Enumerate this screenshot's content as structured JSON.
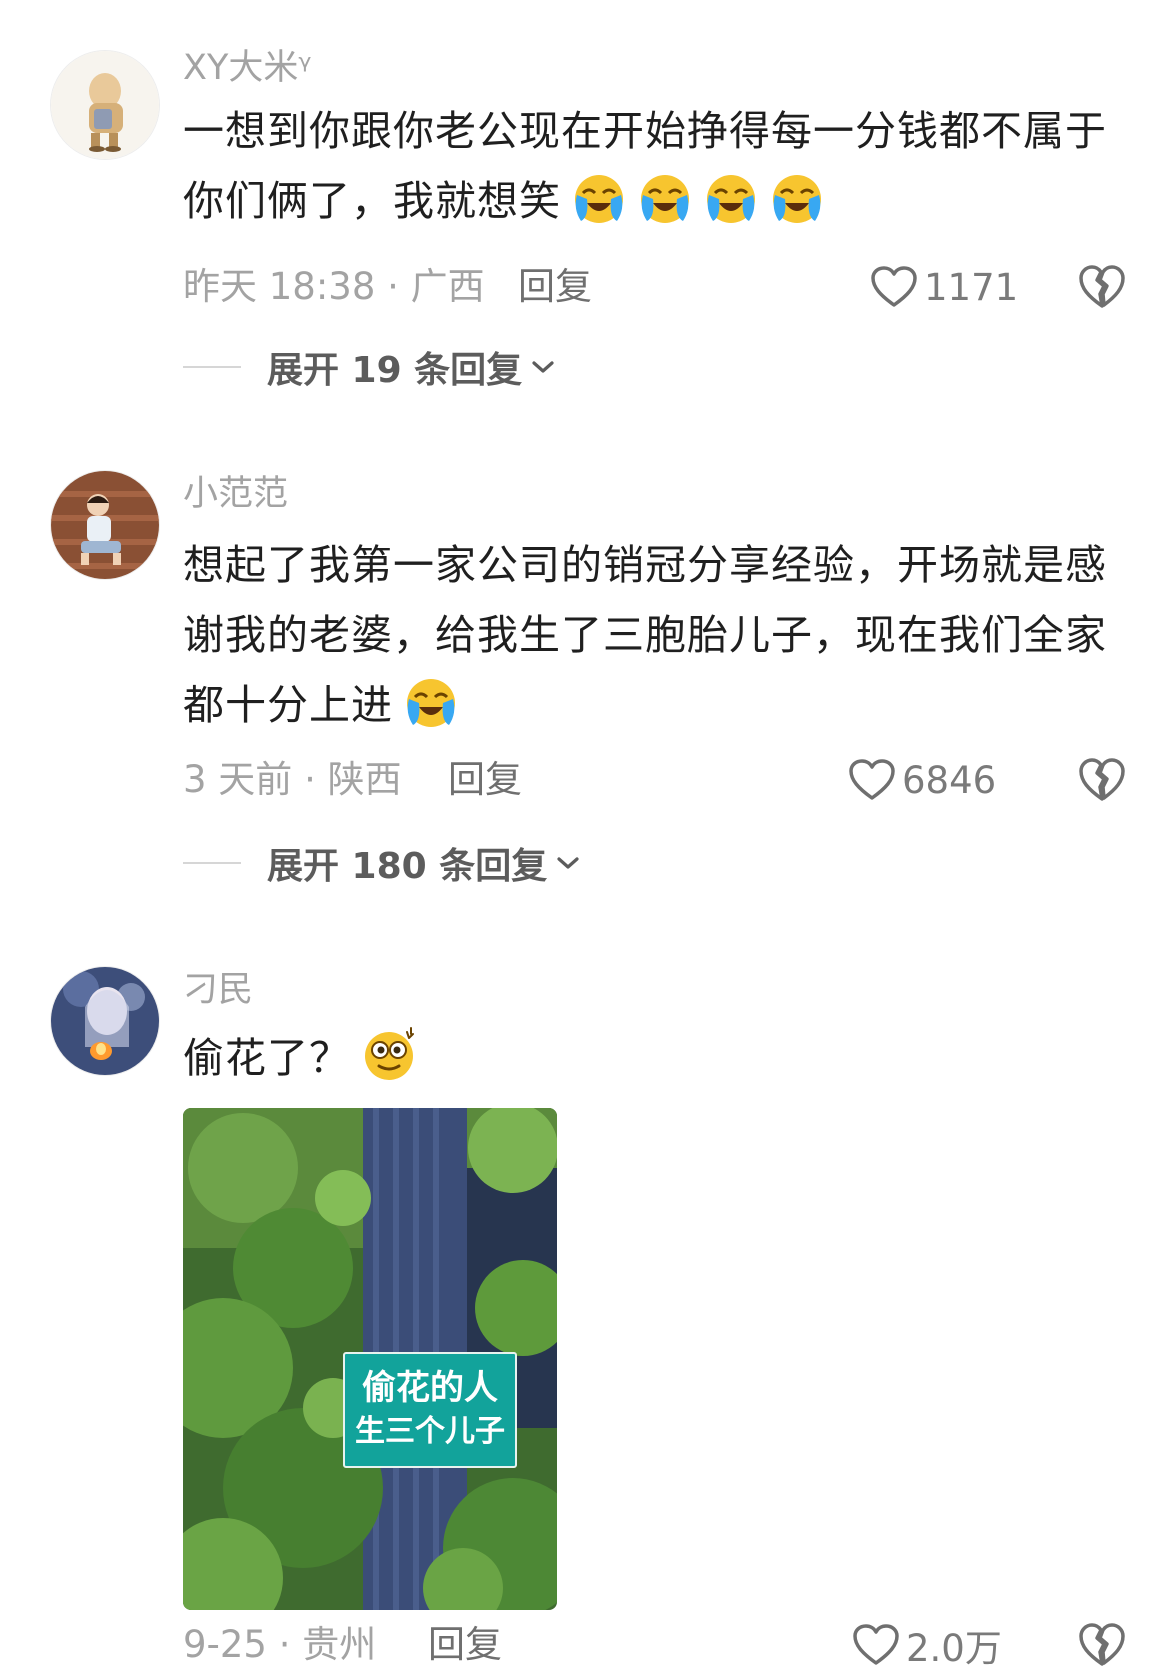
{
  "comments": [
    {
      "username": "XY大米ᵞ",
      "text": "一想到你跟你老公现在开始挣得每一分钱都不属于你们俩了，我就想笑",
      "emoji": "crying-laughing-emoji",
      "time": "昨天 18:38 · 广西",
      "reply_label": "回复",
      "likes": "1171",
      "expand_label": "展开 19 条回复"
    },
    {
      "username": "小范范",
      "text": "想起了我第一家公司的销冠分享经验，开场就是感谢我的老婆，给我生了三胞胎儿子，现在我们全家都十分上进",
      "emoji": "crying-laughing-emoji",
      "time": "3 天前 · 陕西",
      "reply_label": "回复",
      "likes": "6846",
      "expand_label": "展开 180 条回复"
    },
    {
      "username": "刁民",
      "text": "偷花了？",
      "emoji": "dazed-emoji",
      "photo": {
        "sign_line1": "偷花的人",
        "sign_line2": "生三个儿子"
      },
      "time": "9-25 · 贵州",
      "reply_label": "回复",
      "likes": "2.0万"
    }
  ],
  "icons": {
    "like": "heart-outline-icon",
    "dislike": "broken-heart-icon",
    "expand": "chevron-down-icon"
  },
  "colors": {
    "meta_text": "#a3a3a3",
    "body_text": "#1f1f1f",
    "emoji_face": "#f7c52f",
    "emoji_tears": "#38a8f2"
  }
}
